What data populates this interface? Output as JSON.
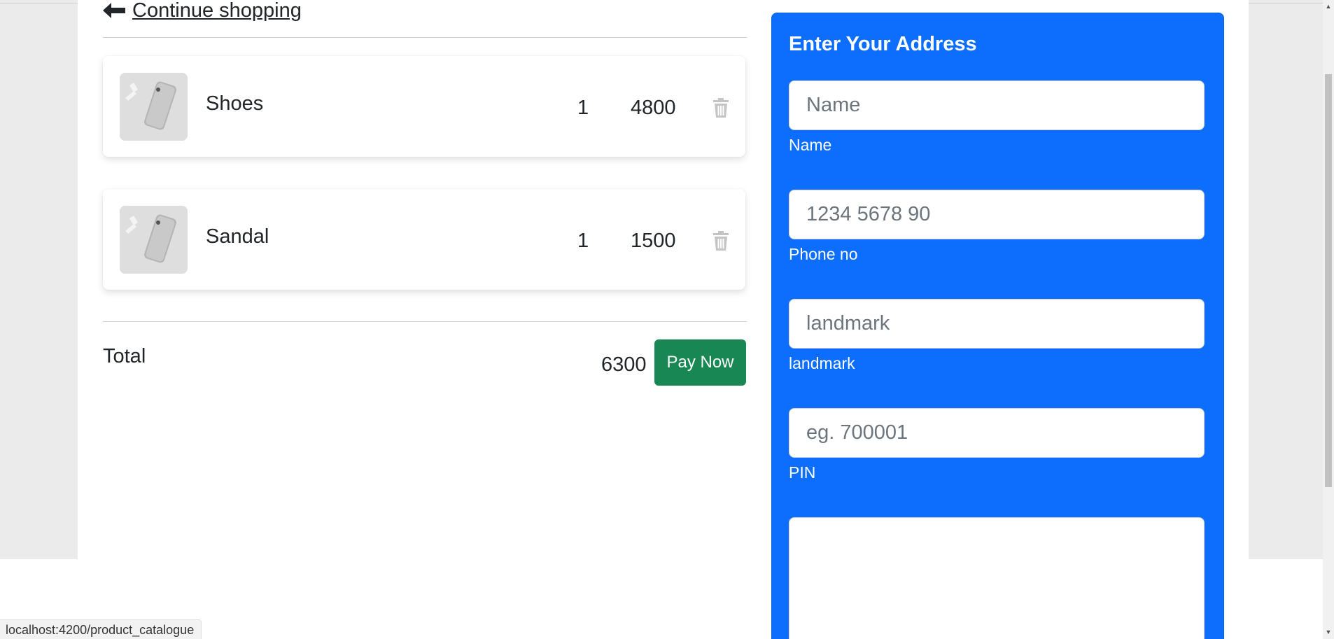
{
  "nav": {
    "continue_label": "Continue shopping"
  },
  "cart": {
    "items": [
      {
        "name": "Shoes",
        "quantity": "1",
        "price": "4800",
        "image": "phone-product-image"
      },
      {
        "name": "Sandal",
        "quantity": "1",
        "price": "1500",
        "image": "phone-product-image"
      }
    ],
    "total_label": "Total",
    "total_value": "6300",
    "pay_label": "Pay Now"
  },
  "address": {
    "title": "Enter Your Address",
    "fields": [
      {
        "placeholder": "Name",
        "label": "Name"
      },
      {
        "placeholder": "1234 5678 90",
        "label": "Phone no"
      },
      {
        "placeholder": "landmark",
        "label": "landmark"
      },
      {
        "placeholder": "eg. 700001",
        "label": "PIN"
      }
    ]
  },
  "status_bar": {
    "url": "localhost:4200/product_catalogue"
  },
  "icons": {
    "back": "arrow-left-icon",
    "delete": "trash-icon"
  },
  "colors": {
    "panel_blue": "#0d6efd",
    "pay_green": "#198754",
    "trash_gray": "#c4c4c4"
  }
}
